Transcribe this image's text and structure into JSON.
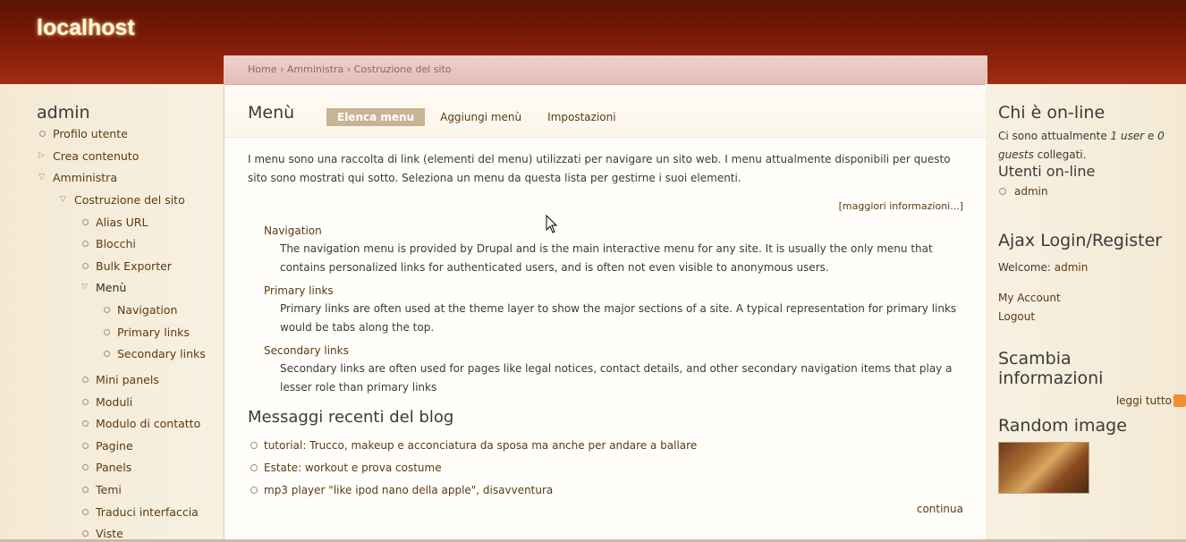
{
  "site": {
    "name": "localhost"
  },
  "breadcrumb": [
    "Home",
    "Amministra",
    "Costruzione del sito"
  ],
  "breadcrumb_sep": "›",
  "page": {
    "title": "Menù",
    "tabs": [
      {
        "label": "Elenca menu",
        "active": true
      },
      {
        "label": "Aggiungi menù",
        "active": false
      },
      {
        "label": "Impostazioni",
        "active": false
      }
    ],
    "help_text": "I menu sono una raccolta di link (elementi del menu) utilizzati per navigare un sito web. I menu attualmente disponibili per questo sito sono mostrati qui sotto. Seleziona un menu da questa lista per gestirne i suoi elementi.",
    "more_info": "[maggiori informazioni...]",
    "menus": [
      {
        "name": "Navigation",
        "description": "The navigation menu is provided by Drupal and is the main interactive menu for any site. It is usually the only menu that contains personalized links for authenticated users, and is often not even visible to anonymous users."
      },
      {
        "name": "Primary links",
        "description": "Primary links are often used at the theme layer to show the major sections of a site. A typical representation for primary links would be tabs along the top."
      },
      {
        "name": "Secondary links",
        "description": "Secondary links are often used for pages like legal notices, contact details, and other secondary navigation items that play a lesser role than primary links"
      }
    ],
    "blog": {
      "heading": "Messaggi recenti del blog",
      "items": [
        "tutorial: Trucco, makeup e acconciatura da sposa ma anche per andare a ballare",
        "Estate: workout e prova costume",
        "mp3 player \"like ipod nano della apple\", disavventura"
      ],
      "more": "continua"
    }
  },
  "left_sidebar": {
    "title": "admin",
    "items": [
      {
        "label": "Profilo utente",
        "marker": "leaf"
      },
      {
        "label": "Crea contenuto",
        "marker": "collapsed"
      },
      {
        "label": "Amministra",
        "marker": "expanded"
      },
      {
        "label": "Costruzione del sito",
        "marker": "expanded"
      },
      {
        "label": "Alias URL",
        "marker": "leaf"
      },
      {
        "label": "Blocchi",
        "marker": "leaf"
      },
      {
        "label": "Bulk Exporter",
        "marker": "leaf"
      },
      {
        "label": "Menù",
        "marker": "expanded",
        "current": true
      },
      {
        "label": "Navigation",
        "marker": "leaf"
      },
      {
        "label": "Primary links",
        "marker": "leaf"
      },
      {
        "label": "Secondary links",
        "marker": "leaf"
      },
      {
        "label": "Mini panels",
        "marker": "leaf"
      },
      {
        "label": "Moduli",
        "marker": "leaf"
      },
      {
        "label": "Modulo di contatto",
        "marker": "leaf"
      },
      {
        "label": "Pagine",
        "marker": "leaf"
      },
      {
        "label": "Panels",
        "marker": "leaf"
      },
      {
        "label": "Temi",
        "marker": "leaf"
      },
      {
        "label": "Traduci interfaccia",
        "marker": "leaf"
      },
      {
        "label": "Viste",
        "marker": "leaf"
      }
    ]
  },
  "right_sidebar": {
    "online": {
      "title": "Chi è on-line",
      "text_prefix": "Ci sono attualmente ",
      "users": "1 user",
      "text_mid": " e ",
      "guests": "0 guests",
      "text_suffix": " collegati.",
      "users_title": "Utenti on-line",
      "users_list": [
        "admin"
      ]
    },
    "ajax_login": {
      "title": "Ajax Login/Register",
      "welcome_prefix": "Welcome: ",
      "welcome_user": "admin",
      "links": [
        "My Account",
        "Logout"
      ]
    },
    "syndicate": {
      "title": "Scambia informazioni",
      "link": "leggi tutto"
    },
    "random_image": {
      "title": "Random image"
    }
  },
  "colors": {
    "header": "#7a1a08",
    "accent_tab": "#c9b394",
    "link": "#5c3a10"
  }
}
